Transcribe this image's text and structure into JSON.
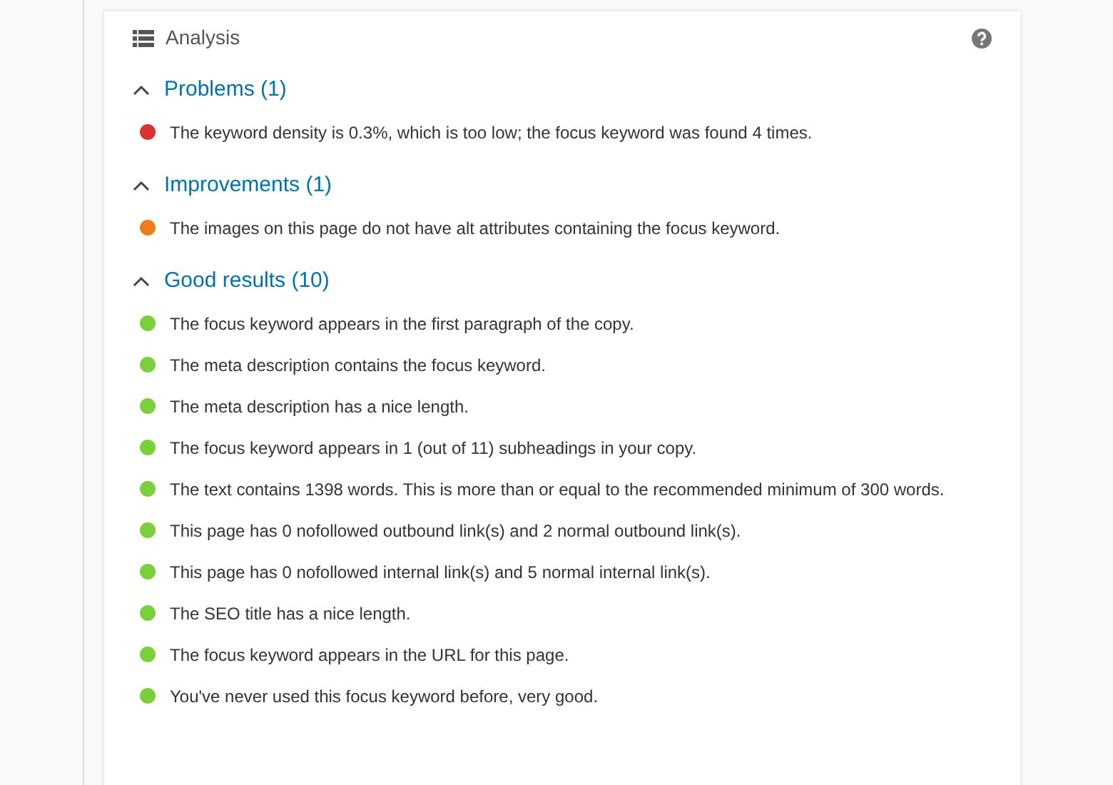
{
  "panel": {
    "title": "Analysis"
  },
  "sections": [
    {
      "heading": "Problems (1)",
      "expanded": true,
      "items": [
        {
          "text": "The keyword density is 0.3%, which is too low; the focus keyword was found 4 times.",
          "color": "#dc3232"
        }
      ]
    },
    {
      "heading": "Improvements (1)",
      "expanded": true,
      "items": [
        {
          "text": "The images on this page do not have alt attributes containing the focus keyword.",
          "color": "#ee7c1b"
        }
      ]
    },
    {
      "heading": "Good results (10)",
      "expanded": true,
      "items": [
        {
          "text": "The focus keyword appears in the first paragraph of the copy.",
          "color": "#7ad03a"
        },
        {
          "text": "The meta description contains the focus keyword.",
          "color": "#7ad03a"
        },
        {
          "text": "The meta description has a nice length.",
          "color": "#7ad03a"
        },
        {
          "text": "The focus keyword appears in 1 (out of 11) subheadings in your copy.",
          "color": "#7ad03a"
        },
        {
          "text": "The text contains 1398 words. This is more than or equal to the recommended minimum of 300 words.",
          "color": "#7ad03a"
        },
        {
          "text": "This page has 0 nofollowed outbound link(s) and 2 normal outbound link(s).",
          "color": "#7ad03a"
        },
        {
          "text": "This page has 0 nofollowed internal link(s) and 5 normal internal link(s).",
          "color": "#7ad03a"
        },
        {
          "text": "The SEO title has a nice length.",
          "color": "#7ad03a"
        },
        {
          "text": "The focus keyword appears in the URL for this page.",
          "color": "#7ad03a"
        },
        {
          "text": "You've never used this focus keyword before, very good.",
          "color": "#7ad03a"
        }
      ]
    }
  ]
}
